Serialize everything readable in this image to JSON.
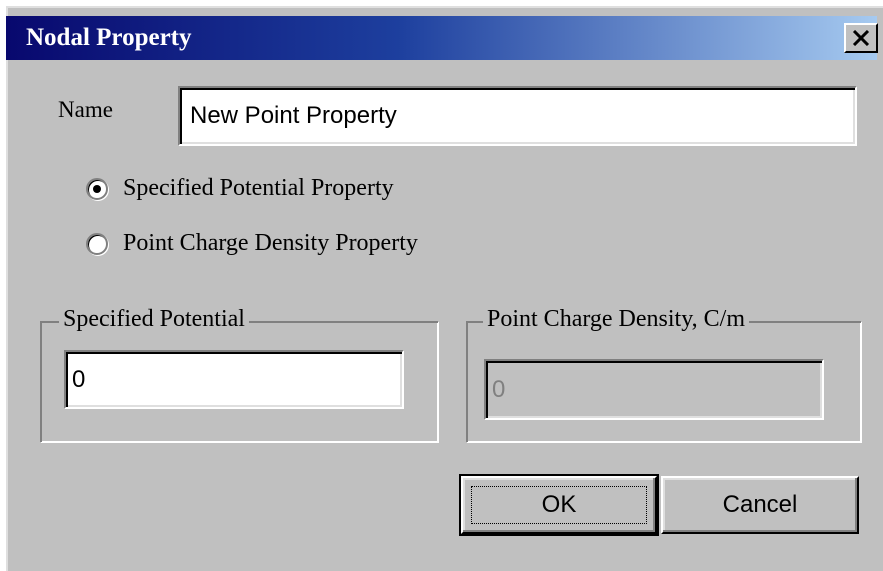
{
  "dialog": {
    "title": "Nodal Property",
    "close_glyph": "✕",
    "colors": {
      "title_gradient_start": "#08086e",
      "title_gradient_end": "#a6caf0",
      "face": "#c0c0c0"
    }
  },
  "name": {
    "label": "Name",
    "value": "New Point Property"
  },
  "property_type": {
    "options": [
      {
        "label": "Specified Potential Property",
        "checked": true
      },
      {
        "label": "Point Charge Density Property",
        "checked": false
      }
    ]
  },
  "specified_potential": {
    "legend": "Specified Potential",
    "value": "0",
    "enabled": true
  },
  "point_charge_density": {
    "legend": "Point Charge Density, C/m",
    "value": "0",
    "enabled": false
  },
  "buttons": {
    "ok_label": "OK",
    "cancel_label": "Cancel"
  }
}
